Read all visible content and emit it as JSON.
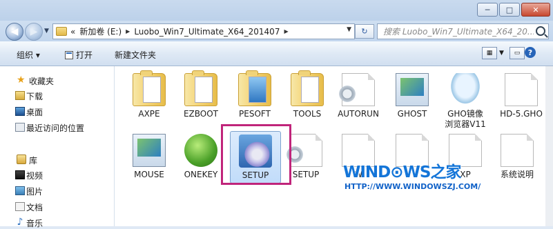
{
  "window": {
    "buttons": {
      "minimize": "─",
      "maximize": "□",
      "close": "✕"
    }
  },
  "address": {
    "crumbs": [
      "«",
      "新加卷 (E:)",
      "Luobo_Win7_Ultimate_X64_201407"
    ],
    "search_placeholder": "搜索 Luobo_Win7_Ultimate_X64_20..."
  },
  "toolbar": {
    "organize": "组织 ▾",
    "open": "打开",
    "new_folder": "新建文件夹"
  },
  "sidebar": {
    "favorites": {
      "label": "收藏夹",
      "items": [
        "下载",
        "桌面",
        "最近访问的位置"
      ]
    },
    "libraries": {
      "label": "库",
      "items": [
        "视频",
        "图片",
        "文档",
        "音乐"
      ]
    }
  },
  "files": [
    {
      "name": "AXPE",
      "type": "folder"
    },
    {
      "name": "EZBOOT",
      "type": "folder"
    },
    {
      "name": "PESOFT",
      "type": "folder-blue"
    },
    {
      "name": "TOOLS",
      "type": "folder"
    },
    {
      "name": "AUTORUN",
      "type": "config"
    },
    {
      "name": "GHOST",
      "type": "app"
    },
    {
      "name": "GHO镜像\n浏览器V11",
      "type": "ghost-explorer"
    },
    {
      "name": "HD-5.GHO",
      "type": "file"
    },
    {
      "name": "MOUSE",
      "type": "app"
    },
    {
      "name": "ONEKEY",
      "type": "onekey"
    },
    {
      "name": "SETUP",
      "type": "setup",
      "selected": true
    },
    {
      "name": "SETUP",
      "type": "config"
    },
    {
      "name": "W",
      "type": "file"
    },
    {
      "name": "",
      "type": "file"
    },
    {
      "name": "XP",
      "type": "file"
    },
    {
      "name": "系统说明",
      "type": "file"
    }
  ],
  "watermark": {
    "title": "WIND⊙WS之家",
    "url": "HTTP://WWW.WINDOWSZJ.COM/"
  }
}
